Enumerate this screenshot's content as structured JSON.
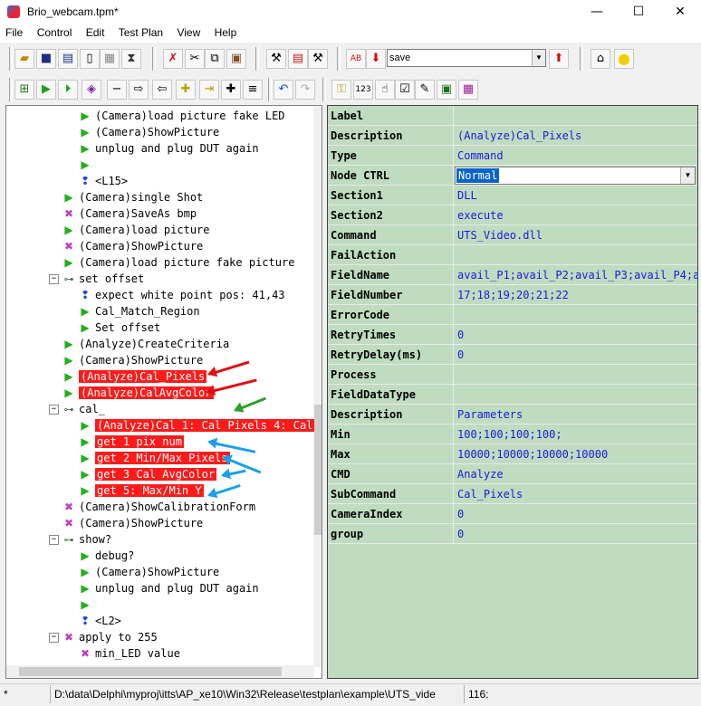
{
  "window": {
    "title": "Brio_webcam.tpm*",
    "minimize": "—",
    "maximize": "☐",
    "close": "✕"
  },
  "menu": [
    "File",
    "Control",
    "Edit",
    "Test Plan",
    "View",
    "Help"
  ],
  "toolbar1": {
    "combo_value": "save",
    "icons": [
      "open-icon",
      "save-icon",
      "save-all-icon",
      "new-icon",
      "print-icon",
      "build-icon",
      "delete-icon",
      "cut-icon",
      "copy-icon",
      "paste-icon",
      "tools-icon",
      "replace-icon",
      "hammer-icon",
      "abc-icon",
      "down-arrow-icon",
      "up-arrow-icon",
      "home-icon",
      "light-icon"
    ]
  },
  "toolbar2": {
    "icons": [
      "tree-add-icon",
      "run-icon",
      "step-icon",
      "debug-icon",
      "minus-icon",
      "right-icon",
      "left-icon",
      "add-child-icon",
      "insert-icon",
      "plus-icon",
      "list-icon",
      "undo-icon",
      "redo-icon",
      "key-icon",
      "number-icon",
      "hand-icon",
      "check-icon",
      "edit-icon",
      "image-icon",
      "select-icon"
    ]
  },
  "tree": [
    {
      "indent": 4,
      "icon": "play",
      "label": "(Camera)load picture fake LED"
    },
    {
      "indent": 4,
      "icon": "play",
      "label": "(Camera)ShowPicture"
    },
    {
      "indent": 4,
      "icon": "play",
      "label": "unplug and plug DUT again"
    },
    {
      "indent": 4,
      "icon": "play",
      "label": ""
    },
    {
      "indent": 4,
      "icon": "info",
      "label": "<L15>"
    },
    {
      "indent": 3,
      "icon": "play",
      "label": "(Camera)single Shot"
    },
    {
      "indent": 3,
      "icon": "x",
      "label": "(Camera)SaveAs bmp"
    },
    {
      "indent": 3,
      "icon": "play",
      "label": "(Camera)load picture"
    },
    {
      "indent": 3,
      "icon": "x",
      "label": "(Camera)ShowPicture"
    },
    {
      "indent": 3,
      "icon": "play",
      "label": "(Camera)load picture fake picture"
    },
    {
      "indent": 3,
      "icon": "grp",
      "label": "set offset",
      "expander": "−"
    },
    {
      "indent": 4,
      "icon": "info",
      "label": "expect  white point pos: 41,43"
    },
    {
      "indent": 4,
      "icon": "play",
      "label": "Cal_Match_Region"
    },
    {
      "indent": 4,
      "icon": "play",
      "label": "Set offset"
    },
    {
      "indent": 3,
      "icon": "play",
      "label": "(Analyze)CreateCriteria"
    },
    {
      "indent": 3,
      "icon": "play",
      "label": "(Camera)ShowPicture"
    },
    {
      "indent": 3,
      "icon": "play",
      "label": "(Analyze)Cal_Pixels",
      "selected": true
    },
    {
      "indent": 3,
      "icon": "play",
      "label": "(Analyze)CalAvgColor",
      "selected": true
    },
    {
      "indent": 3,
      "icon": "grp",
      "label": "cal_",
      "expander": "−"
    },
    {
      "indent": 4,
      "icon": "play",
      "label": "(Analyze)Cal 1: Cal Pixels 4: Cal",
      "selected": true
    },
    {
      "indent": 4,
      "icon": "play",
      "label": "get 1 pix num",
      "selected": true
    },
    {
      "indent": 4,
      "icon": "play",
      "label": "get 2 Min/Max Pixels",
      "selected": true
    },
    {
      "indent": 4,
      "icon": "play",
      "label": "get 3 Cal AvgColor",
      "selected": true
    },
    {
      "indent": 4,
      "icon": "play",
      "label": "get 5: Max/Min Y",
      "selected": true
    },
    {
      "indent": 3,
      "icon": "x",
      "label": "(Camera)ShowCalibrationForm"
    },
    {
      "indent": 3,
      "icon": "x",
      "label": "(Camera)ShowPicture"
    },
    {
      "indent": 3,
      "icon": "grp",
      "label": "show?",
      "expander": "−"
    },
    {
      "indent": 4,
      "icon": "play",
      "label": "debug?"
    },
    {
      "indent": 4,
      "icon": "play",
      "label": "(Camera)ShowPicture"
    },
    {
      "indent": 4,
      "icon": "play",
      "label": "unplug and plug DUT again"
    },
    {
      "indent": 4,
      "icon": "play",
      "label": ""
    },
    {
      "indent": 4,
      "icon": "info",
      "label": "<L2>"
    },
    {
      "indent": 3,
      "icon": "xgrp",
      "label": "apply to 255",
      "expander": "−"
    },
    {
      "indent": 4,
      "icon": "x",
      "label": "min_LED value"
    }
  ],
  "properties": [
    {
      "key": "Label",
      "value": ""
    },
    {
      "key": "Description",
      "value": "(Analyze)Cal_Pixels"
    },
    {
      "key": "Type",
      "value": "Command"
    },
    {
      "key": "Node CTRL",
      "value": "Normal",
      "control": "dropdown"
    },
    {
      "key": "Section1",
      "value": "DLL"
    },
    {
      "key": "Section2",
      "value": "execute"
    },
    {
      "key": "Command",
      "value": "UTS_Video.dll"
    },
    {
      "key": "FailAction",
      "value": ""
    },
    {
      "key": "FieldName",
      "value": "avail_P1;avail_P2;avail_P3;avail_P4;av"
    },
    {
      "key": "FieldNumber",
      "value": "17;18;19;20;21;22"
    },
    {
      "key": "ErrorCode",
      "value": ""
    },
    {
      "key": "RetryTimes",
      "value": "0"
    },
    {
      "key": "RetryDelay(ms)",
      "value": "0"
    },
    {
      "key": "Process",
      "value": ""
    },
    {
      "key": "FieldDataType",
      "value": ""
    },
    {
      "key": "Description",
      "value": "Parameters"
    },
    {
      "key": "Min",
      "value": "100;100;100;100;"
    },
    {
      "key": "Max",
      "value": "10000;10000;10000;10000"
    },
    {
      "key": "CMD",
      "value": "Analyze"
    },
    {
      "key": "SubCommand",
      "value": "Cal_Pixels"
    },
    {
      "key": "CameraIndex",
      "value": "0"
    },
    {
      "key": "group",
      "value": "0"
    }
  ],
  "status": {
    "modified": "*",
    "path": "D:\\data\\Delphi\\myproj\\itts\\AP_xe10\\Win32\\Release\\testplan\\example\\UTS_vide",
    "line": "116:"
  },
  "colors": {
    "selected": "#ff1a1a",
    "props_bg": "#c0dcc0",
    "value_text": "#1a1adc",
    "red_arrow": "#e01010",
    "blue_arrow": "#1aa0e8",
    "green_arrow": "#2aa02a"
  }
}
